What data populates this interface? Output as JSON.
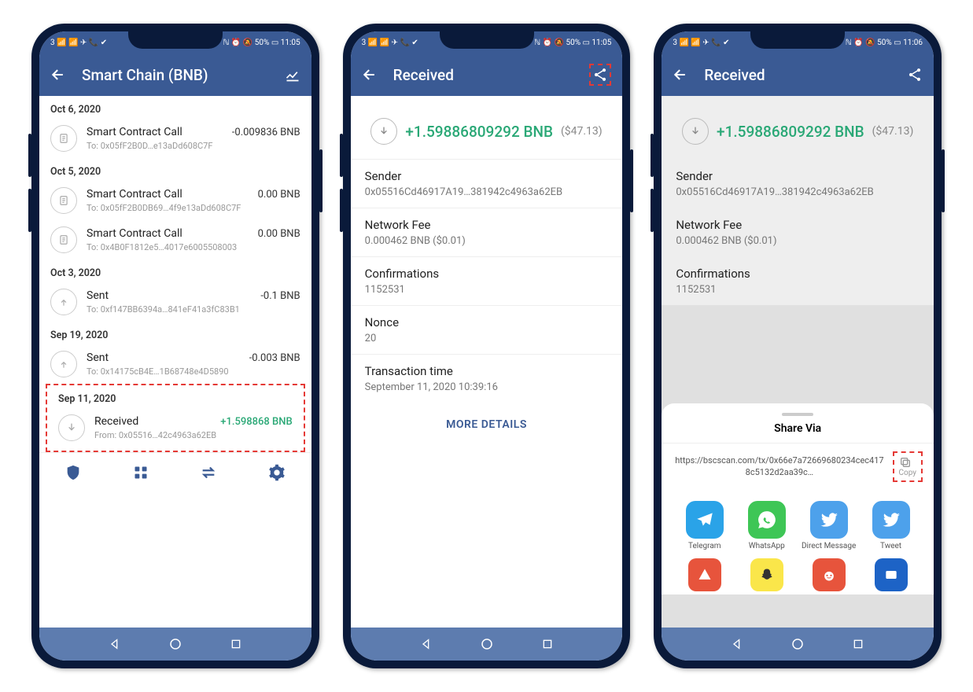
{
  "screen1": {
    "status_left": "3 📶 📶 ✈ 📞 ✔",
    "status_right": "ℕ ⏰ 🔕 50% ▭ 11:05",
    "header_title": "Smart Chain (BNB)",
    "sections": [
      {
        "date": "Oct 6, 2020",
        "txs": [
          {
            "type": "contract",
            "title": "Smart Contract Call",
            "amount": "-0.009836 BNB",
            "sub": "To: 0x05fF2B0D…e13aDd608C7F"
          }
        ]
      },
      {
        "date": "Oct 5, 2020",
        "txs": [
          {
            "type": "contract",
            "title": "Smart Contract Call",
            "amount": "0.00 BNB",
            "sub": "To: 0x05fF2B0DB69…4f9e13aDd608C7F"
          },
          {
            "type": "contract",
            "title": "Smart Contract Call",
            "amount": "0.00 BNB",
            "sub": "To: 0x4B0F1812e5…4017e6005508003"
          }
        ]
      },
      {
        "date": "Oct 3, 2020",
        "txs": [
          {
            "type": "sent",
            "title": "Sent",
            "amount": "-0.1 BNB",
            "sub": "To: 0xf147BB6394a…841eF41a3fC83B1"
          }
        ]
      },
      {
        "date": "Sep 19, 2020",
        "txs": [
          {
            "type": "sent",
            "title": "Sent",
            "amount": "-0.003 BNB",
            "sub": "To: 0x14175cB4E…1B68748e4D5890"
          }
        ]
      }
    ],
    "highlight": {
      "date": "Sep 11, 2020",
      "title": "Received",
      "amount": "+1.598868 BNB",
      "sub": "From: 0x05516…42c4963a62EB"
    }
  },
  "screen2": {
    "status_left": "3 📶 📶 ✈ 📞 ✔",
    "status_right": "ℕ ⏰ 🔕 50% ▭ 11:05",
    "header_title": "Received",
    "amount_value": "+1.59886809292 BNB",
    "amount_usd": "($47.13)",
    "details": [
      {
        "label": "Sender",
        "value": "0x05516Cd46917A19…381942c4963a62EB"
      },
      {
        "label": "Network Fee",
        "value": "0.000462 BNB ($0.01)"
      },
      {
        "label": "Confirmations",
        "value": "1152531"
      },
      {
        "label": "Nonce",
        "value": "20"
      },
      {
        "label": "Transaction time",
        "value": "September 11, 2020 10:39:16"
      }
    ],
    "more_details": "MORE DETAILS"
  },
  "screen3": {
    "status_left": "3 📶 📶 ✈ 📞 ✔",
    "status_right": "ℕ ⏰ 🔕 50% ▭ 11:06",
    "header_title": "Received",
    "amount_value": "+1.59886809292 BNB",
    "amount_usd": "($47.13)",
    "details": [
      {
        "label": "Sender",
        "value": "0x05516Cd46917A19…381942c4963a62EB"
      },
      {
        "label": "Network Fee",
        "value": "0.000462 BNB ($0.01)"
      },
      {
        "label": "Confirmations",
        "value": "1152531"
      }
    ],
    "sheet_title": "Share Via",
    "sheet_url": "https://bscscan.com/tx/0x66e7a72669680234cec4178c5132d2aa39c…",
    "copy_label": "Copy",
    "apps_row1": [
      {
        "icon": "telegram",
        "label": "Telegram"
      },
      {
        "icon": "whatsapp",
        "label": "WhatsApp"
      },
      {
        "icon": "twitter",
        "label": "Direct Message"
      },
      {
        "icon": "twitter",
        "label": "Tweet"
      }
    ],
    "apps_row2": [
      {
        "icon": "orange"
      },
      {
        "icon": "yellow"
      },
      {
        "icon": "reddit"
      },
      {
        "icon": "blue"
      }
    ]
  }
}
